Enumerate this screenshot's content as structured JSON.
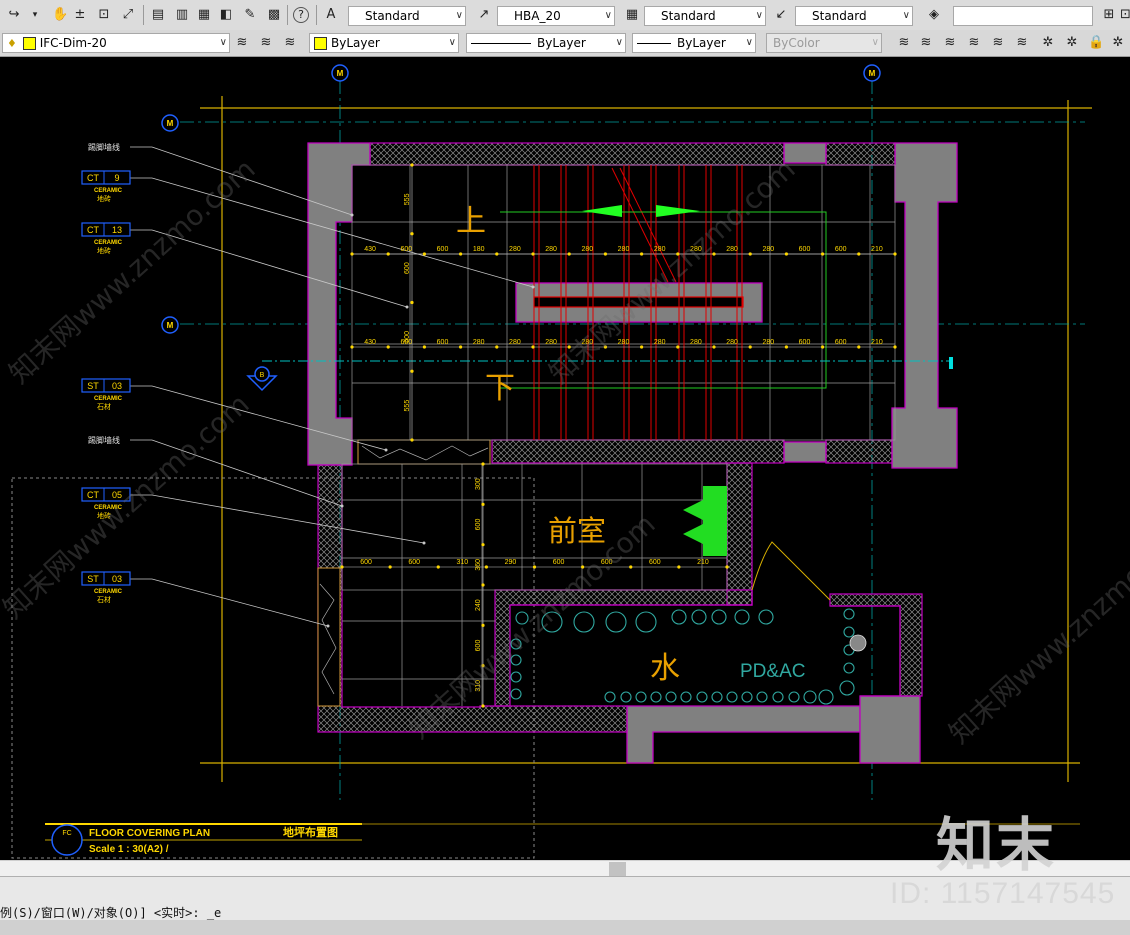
{
  "toolbar1": {
    "text_style": "Standard",
    "dim_style": "HBA_20",
    "table_style": "Standard",
    "multileader_style": "Standard",
    "search_value": ""
  },
  "toolbar2": {
    "layer": "IFC-Dim-20",
    "color": "ByLayer",
    "linetype": "ByLayer",
    "lineweight": "ByLayer",
    "plotstyle": "ByColor"
  },
  "drawing": {
    "column_marker": "M",
    "section_mark": "B",
    "leaders": [
      {
        "top": "踢脚墙线",
        "tag": "",
        "num": "",
        "sub1": "",
        "sub2": ""
      },
      {
        "top": "",
        "tag": "CT",
        "num": "9",
        "sub1": "CERAMIC",
        "sub2": "地砖"
      },
      {
        "top": "",
        "tag": "CT",
        "num": "13",
        "sub1": "CERAMIC",
        "sub2": "地砖"
      },
      {
        "top": "",
        "tag": "ST",
        "num": "03",
        "sub1": "CERAMIC",
        "sub2": "石材"
      },
      {
        "top": "踢脚墙线",
        "tag": "",
        "num": "",
        "sub1": "",
        "sub2": ""
      },
      {
        "top": "",
        "tag": "CT",
        "num": "05",
        "sub1": "CERAMIC",
        "sub2": "地砖"
      },
      {
        "top": "",
        "tag": "ST",
        "num": "03",
        "sub1": "CERAMIC",
        "sub2": "石材"
      }
    ],
    "room_up": "上",
    "room_down": "下",
    "room_lobby": "前室",
    "room_water": "水",
    "shaft_label": "PD&AC",
    "dims_row1": [
      "430",
      "600",
      "600",
      "180",
      "280",
      "280",
      "280",
      "280",
      "280",
      "280",
      "280",
      "280",
      "600",
      "600",
      "210"
    ],
    "dims_row2": [
      "430",
      "600",
      "600",
      "280",
      "280",
      "280",
      "280",
      "280",
      "280",
      "280",
      "280",
      "280",
      "600",
      "600",
      "210"
    ],
    "dims_row3": [
      "600",
      "600",
      "310",
      "290",
      "600",
      "600",
      "600",
      "210"
    ],
    "dims_v1": [
      "555",
      "600",
      "600",
      "555"
    ],
    "dims_v2": [
      "300",
      "600",
      "360",
      "240",
      "600",
      "310"
    ],
    "title_code": "FC",
    "title_en": "FLOOR COVERING PLAN",
    "title_cn": "地坪布置图",
    "title_scale": "Scale 1 : 30(A2) /",
    "watermark": "知末网www.znzmo.com"
  },
  "command_line": "例(S)/窗口(W)/对象(O)] <实时>: _e",
  "watermark_logo": "知末",
  "watermark_id": "ID: 1157147545"
}
